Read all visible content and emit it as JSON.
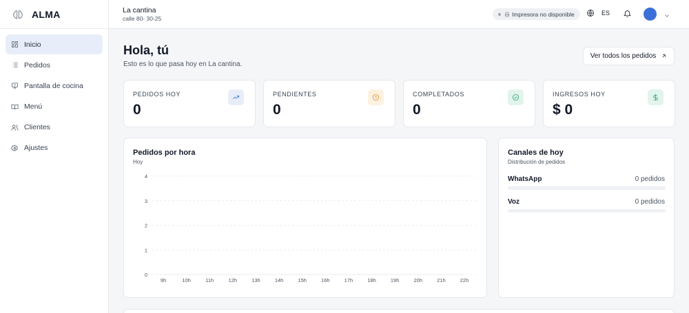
{
  "brand": {
    "name": "ALMA"
  },
  "sidebar": {
    "items": [
      {
        "label": "Inicio",
        "icon": "grid-icon",
        "active": true
      },
      {
        "label": "Pedidos",
        "icon": "list-icon",
        "active": false
      },
      {
        "label": "Pantalla de cocina",
        "icon": "monitor-icon",
        "active": false
      },
      {
        "label": "Menú",
        "icon": "book-icon",
        "active": false
      },
      {
        "label": "Clientes",
        "icon": "users-icon",
        "active": false
      },
      {
        "label": "Ajustes",
        "icon": "gear-icon",
        "active": false
      }
    ]
  },
  "header": {
    "venue_name": "La cantina",
    "venue_address": "calle 80- 30-25",
    "printer_status": "Impresora no disponible",
    "language": "ES"
  },
  "main": {
    "greeting": "Hola, tú",
    "subtitle": "Esto es lo que pasa hoy en La cantina.",
    "view_all_label": "Ver todos los pedidos"
  },
  "stats": [
    {
      "label": "PEDIDOS HOY",
      "value": "0",
      "icon": "trending-up-icon",
      "color": "#3b6fd8",
      "bg": "#e8eef9"
    },
    {
      "label": "PENDIENTES",
      "value": "0",
      "icon": "clock-icon",
      "color": "#e08a1e",
      "bg": "#fdf1e0"
    },
    {
      "label": "COMPLETADOS",
      "value": "0",
      "icon": "check-circle-icon",
      "color": "#1f9d6e",
      "bg": "#e2f4ec"
    },
    {
      "label": "INGRESOS HOY",
      "value": "$ 0",
      "icon": "dollar-icon",
      "color": "#1f9d6e",
      "bg": "#e2f4ec"
    }
  ],
  "hourly": {
    "title": "Pedidos por hora",
    "subtitle": "Hoy"
  },
  "channels": {
    "title": "Canales de hoy",
    "subtitle": "Distribución de pedidos",
    "items": [
      {
        "name": "WhatsApp",
        "count_label": "0 pedidos",
        "share": 0
      },
      {
        "name": "Voz",
        "count_label": "0 pedidos",
        "share": 0
      }
    ]
  },
  "chart_data": {
    "type": "line",
    "title": "Pedidos por hora",
    "subtitle": "Hoy",
    "categories": [
      "9h",
      "10h",
      "11h",
      "12h",
      "13h",
      "14h",
      "15h",
      "16h",
      "17h",
      "18h",
      "19h",
      "20h",
      "21h",
      "22h"
    ],
    "values": [
      0,
      0,
      0,
      0,
      0,
      0,
      0,
      0,
      0,
      0,
      0,
      0,
      0,
      0
    ],
    "ylim": [
      0,
      4
    ],
    "yticks": [
      0,
      1,
      2,
      3,
      4
    ],
    "grid": true
  }
}
